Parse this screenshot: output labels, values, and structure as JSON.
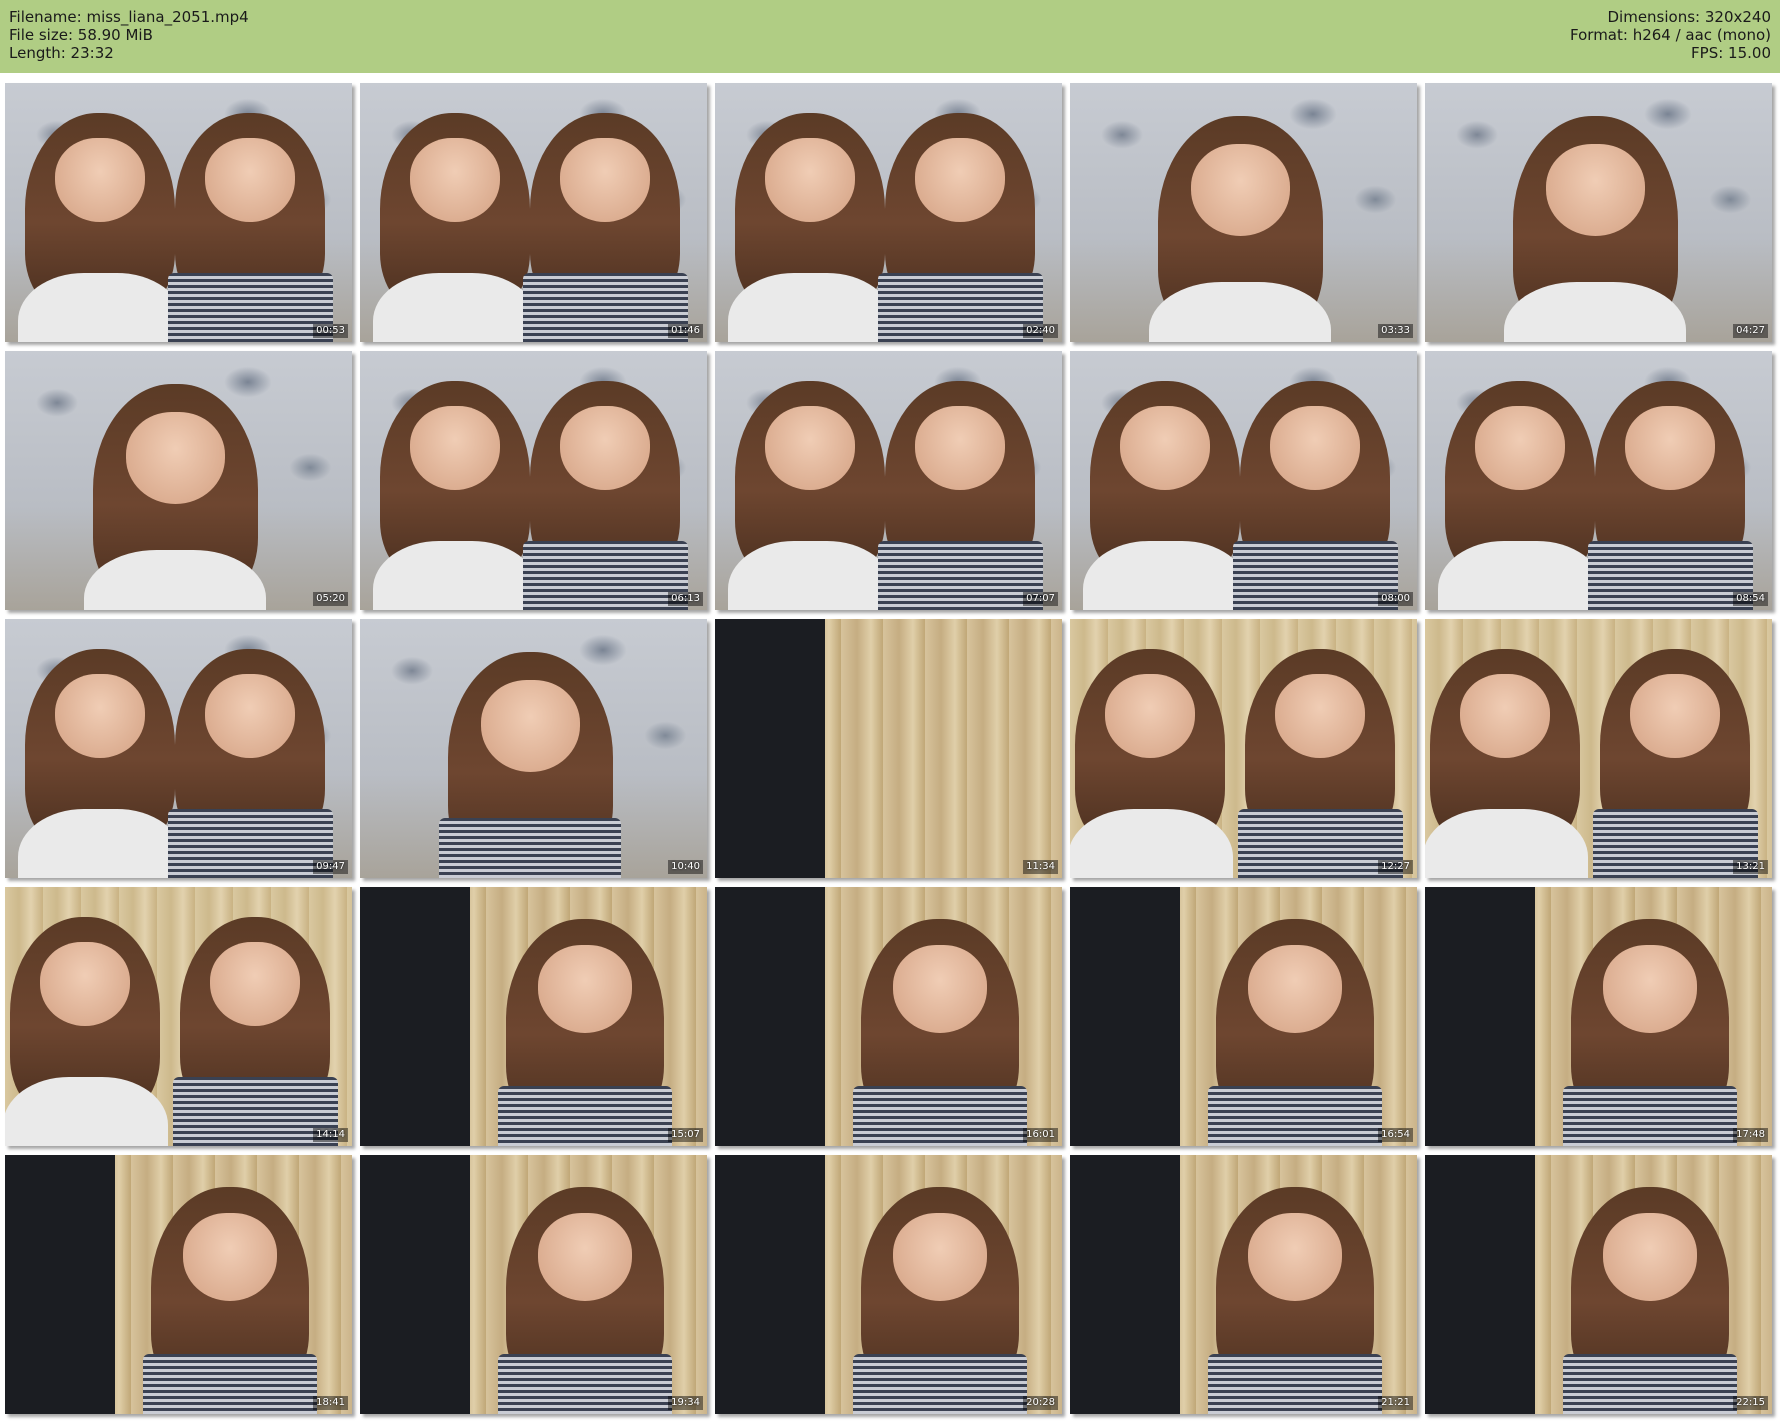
{
  "header": {
    "filename_line": "Filename: miss_liana_2051.mp4",
    "filesize_line": "File size: 58.90 MiB",
    "length_line": "Length: 23:32",
    "dimensions_line": "Dimensions: 320x240",
    "format_line": "Format: h264 / aac (mono)",
    "fps_line": "FPS: 15.00",
    "background_color": "#b0cd84"
  },
  "thumbnails": [
    {
      "time": "00:53",
      "scene": "wallpaper",
      "people": 2
    },
    {
      "time": "01:46",
      "scene": "wallpaper",
      "people": 2
    },
    {
      "time": "02:40",
      "scene": "wallpaper",
      "people": 2
    },
    {
      "time": "03:33",
      "scene": "wallpaper",
      "people": 1
    },
    {
      "time": "04:27",
      "scene": "wallpaper",
      "people": 1
    },
    {
      "time": "05:20",
      "scene": "wallpaper",
      "people": 1
    },
    {
      "time": "06:13",
      "scene": "wallpaper",
      "people": 2
    },
    {
      "time": "07:07",
      "scene": "wallpaper",
      "people": 2
    },
    {
      "time": "08:00",
      "scene": "wallpaper",
      "people": 2
    },
    {
      "time": "08:54",
      "scene": "wallpaper",
      "people": 2
    },
    {
      "time": "09:47",
      "scene": "wallpaper",
      "people": 2
    },
    {
      "time": "10:40",
      "scene": "wallpaper",
      "people": 1
    },
    {
      "time": "11:34",
      "scene": "window",
      "people": 0
    },
    {
      "time": "12:27",
      "scene": "curtain",
      "people": 2
    },
    {
      "time": "13:21",
      "scene": "curtain",
      "people": 2
    },
    {
      "time": "14:14",
      "scene": "curtain",
      "people": 2
    },
    {
      "time": "15:07",
      "scene": "window",
      "people": 1
    },
    {
      "time": "16:01",
      "scene": "window",
      "people": 1
    },
    {
      "time": "16:54",
      "scene": "window",
      "people": 1
    },
    {
      "time": "17:48",
      "scene": "window",
      "people": 1
    },
    {
      "time": "18:41",
      "scene": "window",
      "people": 1
    },
    {
      "time": "19:34",
      "scene": "window",
      "people": 1
    },
    {
      "time": "20:28",
      "scene": "window",
      "people": 1
    },
    {
      "time": "21:21",
      "scene": "window",
      "people": 1
    },
    {
      "time": "22:15",
      "scene": "window",
      "people": 1
    }
  ]
}
